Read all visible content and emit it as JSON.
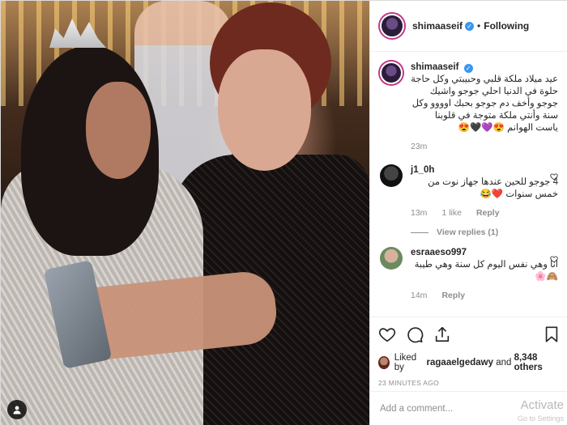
{
  "post": {
    "username": "shimaaseif",
    "follow_state": "Following",
    "separator": "•"
  },
  "caption": {
    "username": "shimaaseif",
    "text": "عيد ميلاد ملكة قلبي وحبيبتي وكل حاجة حلوة في الدنيا احلي جوجو واشيك جوجو وأخف دم جوجو بحبك اوووو وكل سنة وأنتي ملكة متوجة في قلوبنا ياست الهوانم 😍💜🖤😍",
    "time": "23m"
  },
  "comments": [
    {
      "username": "j1_0h",
      "text": "4 جوجو للحين عندها جهاز نوت من خمس سنوات ❤️😂",
      "time": "13m",
      "likes": "1 like",
      "reply_label": "Reply",
      "view_replies": "View replies (1)"
    },
    {
      "username": "esraaeso997",
      "text": "انا وهي نفس اليوم كل سنة وهي طيبة 🙈🌸",
      "time": "14m",
      "reply_label": "Reply"
    }
  ],
  "actions": {
    "icons": [
      "heart-icon",
      "comment-icon",
      "share-icon",
      "bookmark-icon"
    ]
  },
  "likes": {
    "prefix": "Liked by",
    "user": "ragaaelgedawy",
    "conj": "and",
    "others": "8,348 others"
  },
  "posted": "23 MINUTES AGO",
  "add_comment": {
    "placeholder": "Add a comment..."
  },
  "overlay": {
    "watermark": "Activate",
    "watermark_sub": "Go to Settings"
  },
  "colors": {
    "verified": "#3897f0",
    "border": "#dbdbdb",
    "muted": "#8e8e8e"
  }
}
